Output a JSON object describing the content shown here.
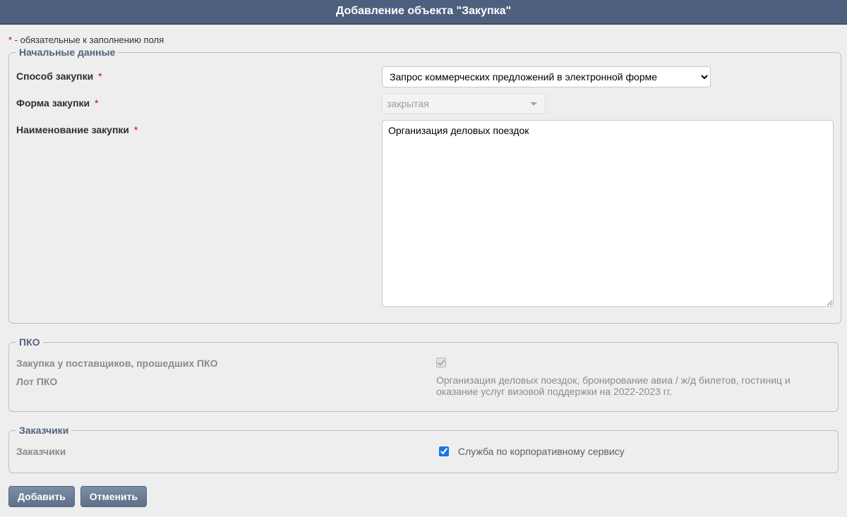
{
  "header": {
    "title": "Добавление объекта \"Закупка\""
  },
  "required_note_text": " - обязательные к заполнению поля",
  "asterisk": "*",
  "fieldset_initial": {
    "legend": "Начальные данные",
    "method_label": "Способ закупки",
    "method_value": "Запрос коммерческих предложений в электронной форме",
    "form_label": "Форма закупки",
    "form_value": "закрытая",
    "name_label": "Наименование закупки",
    "name_value": "Организация деловых поездок"
  },
  "fieldset_pko": {
    "legend": "ПКО",
    "suppliers_label": "Закупка у поставщиков, прошедших ПКО",
    "lot_label": "Лот ПКО",
    "lot_value": "Организация деловых поездок, бронирование авиа / ж/д билетов, гостиниц и оказание услуг визовой поддержки на 2022-2023 гг."
  },
  "fieldset_customers": {
    "legend": "Заказчики",
    "label": "Заказчики",
    "value": "Служба по корпоративному сервису",
    "checked": true
  },
  "buttons": {
    "add": "Добавить",
    "cancel": "Отменить"
  }
}
